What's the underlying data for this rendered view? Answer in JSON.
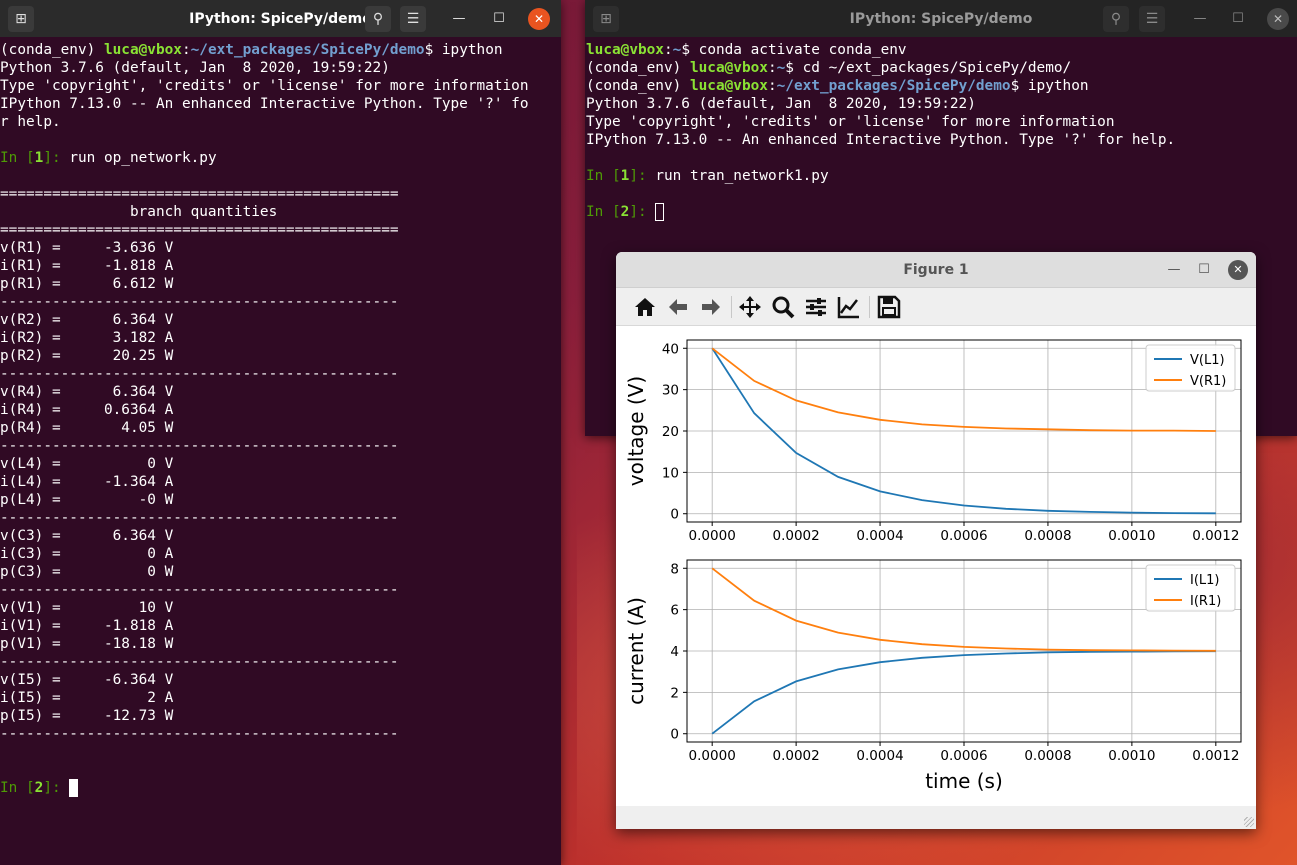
{
  "desktop": {
    "accent": "#e95420",
    "terminal_bg": "#300a24"
  },
  "left_window": {
    "title": "IPython: SpicePy/demo",
    "lines": [
      [
        {
          "t": "(conda_env) "
        },
        {
          "t": "luca@vbox",
          "c": "ugreen"
        },
        {
          "t": ":"
        },
        {
          "t": "~/ext_packages/SpicePy/demo",
          "c": "ublue"
        },
        {
          "t": "$ ipython"
        }
      ],
      [
        {
          "t": "Python 3.7.6 (default, Jan  8 2020, 19:59:22)"
        }
      ],
      [
        {
          "t": "Type 'copyright', 'credits' or 'license' for more information"
        }
      ],
      [
        {
          "t": "IPython 7.13.0 -- An enhanced Interactive Python. Type '?' fo"
        }
      ],
      [
        {
          "t": "r help."
        }
      ],
      [
        {
          "t": ""
        }
      ],
      [
        {
          "t": "In [",
          "c": "pgreen"
        },
        {
          "t": "1",
          "c": "pgreenb"
        },
        {
          "t": "]: ",
          "c": "pgreen"
        },
        {
          "t": "run op_network.py"
        }
      ],
      [
        {
          "t": ""
        }
      ],
      [
        {
          "t": "=============================================="
        }
      ],
      [
        {
          "t": "               branch quantities"
        }
      ],
      [
        {
          "t": "=============================================="
        }
      ],
      [
        {
          "t": "v(R1) =     -3.636 V"
        }
      ],
      [
        {
          "t": "i(R1) =     -1.818 A"
        }
      ],
      [
        {
          "t": "p(R1) =      6.612 W"
        }
      ],
      [
        {
          "t": "----------------------------------------------"
        }
      ],
      [
        {
          "t": "v(R2) =      6.364 V"
        }
      ],
      [
        {
          "t": "i(R2) =      3.182 A"
        }
      ],
      [
        {
          "t": "p(R2) =      20.25 W"
        }
      ],
      [
        {
          "t": "----------------------------------------------"
        }
      ],
      [
        {
          "t": "v(R4) =      6.364 V"
        }
      ],
      [
        {
          "t": "i(R4) =     0.6364 A"
        }
      ],
      [
        {
          "t": "p(R4) =       4.05 W"
        }
      ],
      [
        {
          "t": "----------------------------------------------"
        }
      ],
      [
        {
          "t": "v(L4) =          0 V"
        }
      ],
      [
        {
          "t": "i(L4) =     -1.364 A"
        }
      ],
      [
        {
          "t": "p(L4) =         -0 W"
        }
      ],
      [
        {
          "t": "----------------------------------------------"
        }
      ],
      [
        {
          "t": "v(C3) =      6.364 V"
        }
      ],
      [
        {
          "t": "i(C3) =          0 A"
        }
      ],
      [
        {
          "t": "p(C3) =          0 W"
        }
      ],
      [
        {
          "t": "----------------------------------------------"
        }
      ],
      [
        {
          "t": "v(V1) =         10 V"
        }
      ],
      [
        {
          "t": "i(V1) =     -1.818 A"
        }
      ],
      [
        {
          "t": "p(V1) =     -18.18 W"
        }
      ],
      [
        {
          "t": "----------------------------------------------"
        }
      ],
      [
        {
          "t": "v(I5) =     -6.364 V"
        }
      ],
      [
        {
          "t": "i(I5) =          2 A"
        }
      ],
      [
        {
          "t": "p(I5) =     -12.73 W"
        }
      ],
      [
        {
          "t": "----------------------------------------------"
        }
      ],
      [
        {
          "t": ""
        }
      ],
      [
        {
          "t": ""
        }
      ],
      [
        {
          "t": "In [",
          "c": "pgreen"
        },
        {
          "t": "2",
          "c": "pgreenb"
        },
        {
          "t": "]: ",
          "c": "pgreen"
        },
        {
          "cursor": "block"
        }
      ]
    ]
  },
  "right_window": {
    "title": "IPython: SpicePy/demo",
    "lines": [
      [
        {
          "t": "luca@vbox",
          "c": "ugreen"
        },
        {
          "t": ":"
        },
        {
          "t": "~",
          "c": "ublue"
        },
        {
          "t": "$ conda activate conda_env"
        }
      ],
      [
        {
          "t": "(conda_env) "
        },
        {
          "t": "luca@vbox",
          "c": "ugreen"
        },
        {
          "t": ":"
        },
        {
          "t": "~",
          "c": "ublue"
        },
        {
          "t": "$ cd ~/ext_packages/SpicePy/demo/"
        }
      ],
      [
        {
          "t": "(conda_env) "
        },
        {
          "t": "luca@vbox",
          "c": "ugreen"
        },
        {
          "t": ":"
        },
        {
          "t": "~/ext_packages/SpicePy/demo",
          "c": "ublue"
        },
        {
          "t": "$ ipython"
        }
      ],
      [
        {
          "t": "Python 3.7.6 (default, Jan  8 2020, 19:59:22)"
        }
      ],
      [
        {
          "t": "Type 'copyright', 'credits' or 'license' for more information"
        }
      ],
      [
        {
          "t": "IPython 7.13.0 -- An enhanced Interactive Python. Type '?' for help."
        }
      ],
      [
        {
          "t": ""
        }
      ],
      [
        {
          "t": "In [",
          "c": "pgreen"
        },
        {
          "t": "1",
          "c": "pgreenb"
        },
        {
          "t": "]: ",
          "c": "pgreen"
        },
        {
          "t": "run tran_network1.py"
        }
      ],
      [
        {
          "t": ""
        }
      ],
      [
        {
          "t": "In [",
          "c": "pgreen"
        },
        {
          "t": "2",
          "c": "pgreenb"
        },
        {
          "t": "]: ",
          "c": "pgreen"
        },
        {
          "cursor": "outline"
        }
      ]
    ]
  },
  "window_controls": {
    "minimize": "—",
    "maximize": "☐",
    "close": "✕",
    "new_tab": "⊞",
    "search": "⚲",
    "menu": "☰"
  },
  "figure": {
    "title": "Figure 1",
    "toolbar": [
      "home-icon",
      "back-icon",
      "forward-icon",
      "pan-icon",
      "zoom-icon",
      "subplots-icon",
      "axes-edit-icon",
      "save-icon"
    ]
  },
  "chart_data": [
    {
      "type": "line",
      "title": "",
      "xlabel": "",
      "ylabel": "voltage (V)",
      "xlim": [
        -6e-05,
        0.00126
      ],
      "ylim": [
        -2,
        42
      ],
      "xticks": [
        "0.0000",
        "0.0002",
        "0.0004",
        "0.0006",
        "0.0008",
        "0.0010",
        "0.0012"
      ],
      "xtick_values": [
        0,
        0.0002,
        0.0004,
        0.0006,
        0.0008,
        0.001,
        0.0012
      ],
      "yticks": [
        0,
        10,
        20,
        30,
        40
      ],
      "grid": true,
      "legend": "top-right",
      "x": [
        0,
        0.0001,
        0.0002,
        0.0003,
        0.0004,
        0.0005,
        0.0006,
        0.0007,
        0.0008,
        0.0009,
        0.001,
        0.0011,
        0.0012
      ],
      "series": [
        {
          "name": "V(L1)",
          "color": "#1f77b4",
          "values": [
            40,
            24.3,
            14.7,
            8.9,
            5.4,
            3.3,
            2.0,
            1.2,
            0.7,
            0.45,
            0.27,
            0.16,
            0.1
          ]
        },
        {
          "name": "V(R1)",
          "color": "#ff7f0e",
          "values": [
            40,
            32.1,
            27.4,
            24.5,
            22.7,
            21.6,
            21.0,
            20.6,
            20.4,
            20.2,
            20.1,
            20.1,
            20.0
          ]
        }
      ]
    },
    {
      "type": "line",
      "title": "",
      "xlabel": "time (s)",
      "ylabel": "current (A)",
      "xlim": [
        -6e-05,
        0.00126
      ],
      "ylim": [
        -0.4,
        8.4
      ],
      "xticks": [
        "0.0000",
        "0.0002",
        "0.0004",
        "0.0006",
        "0.0008",
        "0.0010",
        "0.0012"
      ],
      "xtick_values": [
        0,
        0.0002,
        0.0004,
        0.0006,
        0.0008,
        0.001,
        0.0012
      ],
      "yticks": [
        0,
        2,
        4,
        6,
        8
      ],
      "grid": true,
      "legend": "top-right",
      "x": [
        0,
        0.0001,
        0.0002,
        0.0003,
        0.0004,
        0.0005,
        0.0006,
        0.0007,
        0.0008,
        0.0009,
        0.001,
        0.0011,
        0.0012
      ],
      "series": [
        {
          "name": "I(L1)",
          "color": "#1f77b4",
          "values": [
            0,
            1.57,
            2.53,
            3.11,
            3.46,
            3.67,
            3.8,
            3.88,
            3.93,
            3.96,
            3.97,
            3.98,
            3.99
          ]
        },
        {
          "name": "I(R1)",
          "color": "#ff7f0e",
          "values": [
            8,
            6.43,
            5.47,
            4.89,
            4.54,
            4.33,
            4.2,
            4.12,
            4.07,
            4.04,
            4.03,
            4.02,
            4.01
          ]
        }
      ]
    }
  ]
}
